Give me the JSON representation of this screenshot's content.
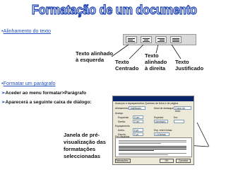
{
  "title": "Formatação de um documento",
  "section1": {
    "bullet": "•",
    "link": "Alinhamento do texto"
  },
  "labels": {
    "left": "Texto alinhado\nà esquerda",
    "center": "Texto\nCentrado",
    "right": "Texto\nalinhado\nà direita",
    "justify": "Texto\nJustificado"
  },
  "section2": {
    "bullet": "•",
    "link": "Formatar um parágrafo",
    "step1": "Aceder ao menu formatar>Parágrafo",
    "step2": "Aparecerá a seguinte caixa de diálogo:",
    "step_marker": "➢"
  },
  "preview_label": "Janela de pré-\nvisualização das\nformatações\nseleccionadas",
  "dialog": {
    "tabs": "Avanços e espaçamentos   Quebras de linha e de página",
    "alignment_label": "Alinhamento:",
    "alignment_value": "Justificado",
    "level_label": "Nível de destaque:",
    "level_value": "Corpo do texto",
    "indent_label": "Avanço",
    "left_label": "Esquerda:",
    "left_value": "0 cm",
    "right_label": "Direita:",
    "right_value": "0 cm",
    "special_label": "Especial:",
    "special_value": "(nenhum)",
    "by_label": "Em:",
    "spacing_label": "Espaçamento",
    "before_label": "Antes:",
    "before_value": "0 pt",
    "after_label": "Depois:",
    "after_value": "0 pt",
    "line_label": "Esp. entre linhas:",
    "line_value": "1,5 linhas",
    "preview_label": "Pré-visualizar",
    "tabs_button": "Tabulações...",
    "ok_button": "OK",
    "cancel_button": "Cancelar"
  }
}
